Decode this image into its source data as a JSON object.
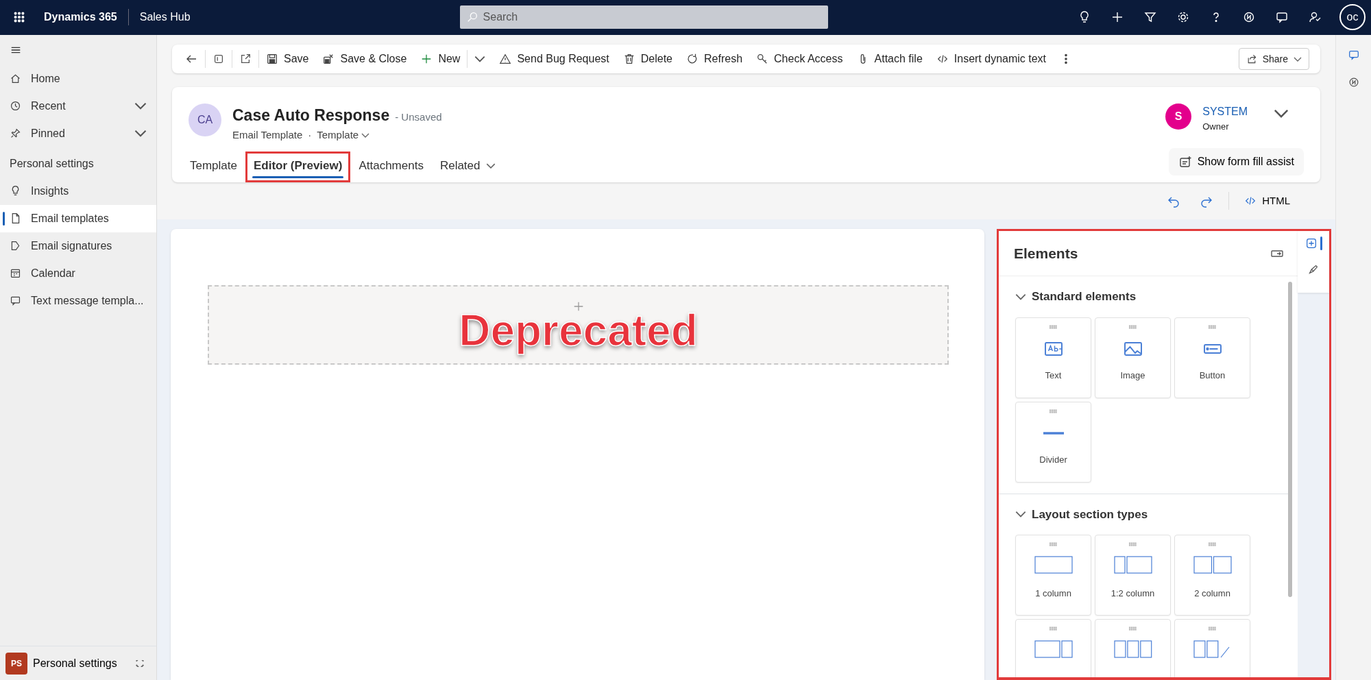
{
  "top_bar": {
    "app_name": "Dynamics 365",
    "area": "Sales Hub",
    "search": {
      "placeholder": "Search"
    },
    "user_initials": "oc"
  },
  "sidebar": {
    "items": [
      {
        "label": "Home",
        "selected": false
      },
      {
        "label": "Recent",
        "selected": false,
        "expanded": false
      },
      {
        "label": "Pinned",
        "selected": false,
        "expanded": false
      }
    ],
    "section_title": "Personal settings",
    "section_items": [
      {
        "label": "Insights",
        "selected": false
      },
      {
        "label": "Email templates",
        "selected": true
      },
      {
        "label": "Email signatures",
        "selected": false
      },
      {
        "label": "Calendar",
        "selected": false
      },
      {
        "label": "Text message templa...",
        "selected": false
      }
    ],
    "area_switcher": {
      "initials": "PS",
      "label": "Personal settings"
    }
  },
  "command_bar": {
    "items": [
      {
        "kind": "back"
      },
      {
        "kind": "icon"
      },
      {
        "kind": "icon"
      },
      {
        "kind": "command",
        "label": "Save"
      },
      {
        "kind": "command",
        "label": "Save & Close"
      },
      {
        "kind": "command",
        "label": "New"
      },
      {
        "kind": "split"
      },
      {
        "kind": "command",
        "label": "Send Bug Request"
      },
      {
        "kind": "command",
        "label": "Delete"
      },
      {
        "kind": "command",
        "label": "Refresh"
      },
      {
        "kind": "command",
        "label": "Check Access"
      },
      {
        "kind": "command",
        "label": "Attach file"
      },
      {
        "kind": "command",
        "label": "Insert dynamic text"
      },
      {
        "kind": "more"
      }
    ],
    "share": "Share"
  },
  "record": {
    "avatar": "CA",
    "title": "Case Auto Response",
    "status": "- Unsaved",
    "entity": "Email Template",
    "separator": "·",
    "form": "Template",
    "owner": {
      "name": "SYSTEM",
      "role": "Owner",
      "initial": "S",
      "color": "#e3008c"
    },
    "tabs": [
      {
        "label": "Template",
        "selected": false,
        "dropdown": false,
        "highlighted": false
      },
      {
        "label": "Editor (Preview)",
        "selected": true,
        "dropdown": false,
        "highlighted": true
      },
      {
        "label": "Attachments",
        "selected": false,
        "dropdown": false,
        "highlighted": false
      },
      {
        "label": "Related",
        "selected": false,
        "dropdown": true,
        "highlighted": false
      }
    ],
    "form_fill_assist": "Show form fill assist"
  },
  "editor_toolbar": {
    "html": "HTML"
  },
  "canvas": {
    "overlay_label": "Deprecated"
  },
  "elements_panel": {
    "title": "Elements",
    "highlighted": true,
    "sections": [
      {
        "title": "Standard elements",
        "expanded": true,
        "items": [
          {
            "kind": "text",
            "label": "Text"
          },
          {
            "kind": "image",
            "label": "Image"
          },
          {
            "kind": "button",
            "label": "Button"
          },
          {
            "kind": "divider",
            "label": "Divider"
          }
        ]
      },
      {
        "title": "Layout section types",
        "expanded": true,
        "items": [
          {
            "kind": "one",
            "label": "1 column"
          },
          {
            "kind": "one-two",
            "label": "1:2 column"
          },
          {
            "kind": "two",
            "label": "2 column"
          },
          {
            "kind": "two-one"
          },
          {
            "kind": "three"
          },
          {
            "kind": "custom"
          }
        ]
      }
    ]
  }
}
